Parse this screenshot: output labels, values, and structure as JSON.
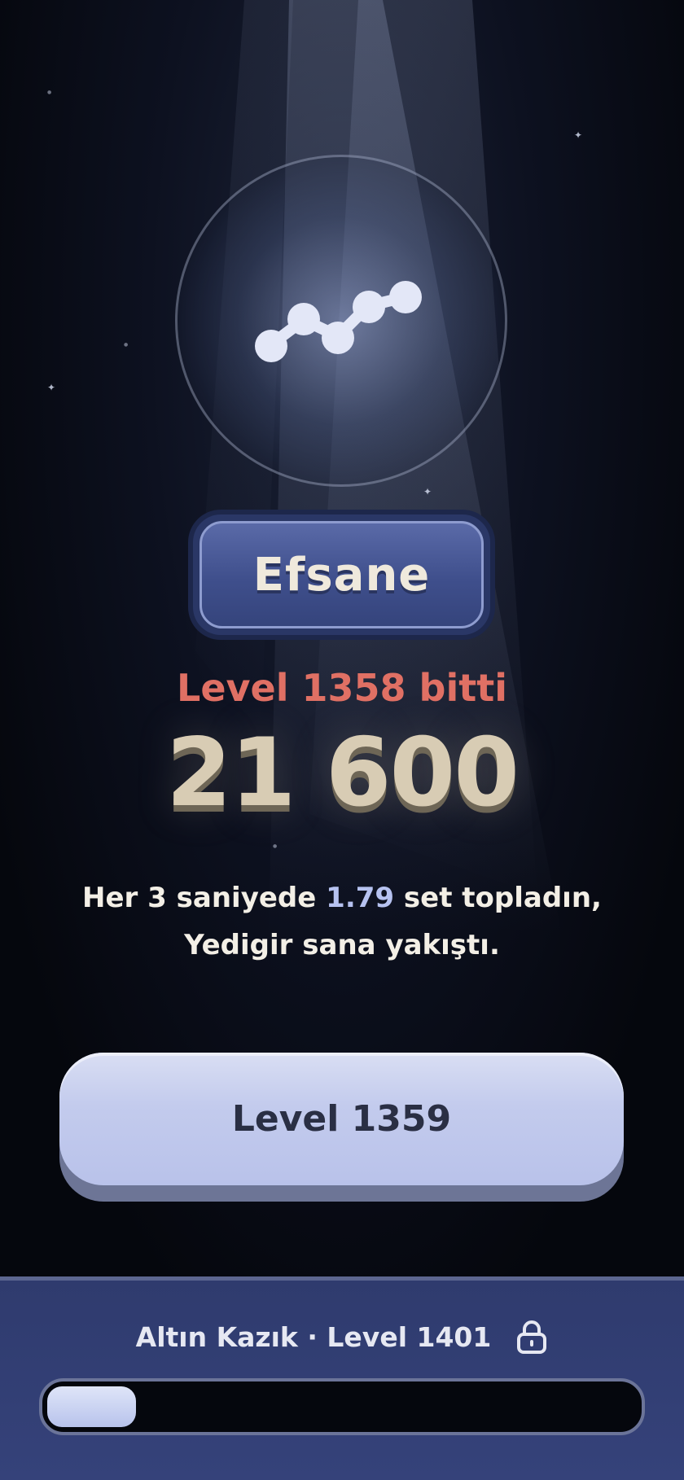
{
  "result": {
    "rank_label": "Efsane",
    "level_done": "Level 1358 bitti",
    "score": "21 600",
    "message": {
      "prefix": "Her 3 saniyede ",
      "highlight": "1.79",
      "suffix": " set topladın,",
      "line2": "Yedigir sana yakıştı."
    }
  },
  "next_button": {
    "label": "Level 1359"
  },
  "goal": {
    "label": "Altın Kazık · Level 1401",
    "icon": "lock-icon",
    "progress": 0.15
  },
  "colors": {
    "accent_red": "#e07064",
    "score_cream": "#d8ccb4",
    "highlight_blue": "#b6c2f0",
    "panel_blue": "#2f3b6e"
  }
}
